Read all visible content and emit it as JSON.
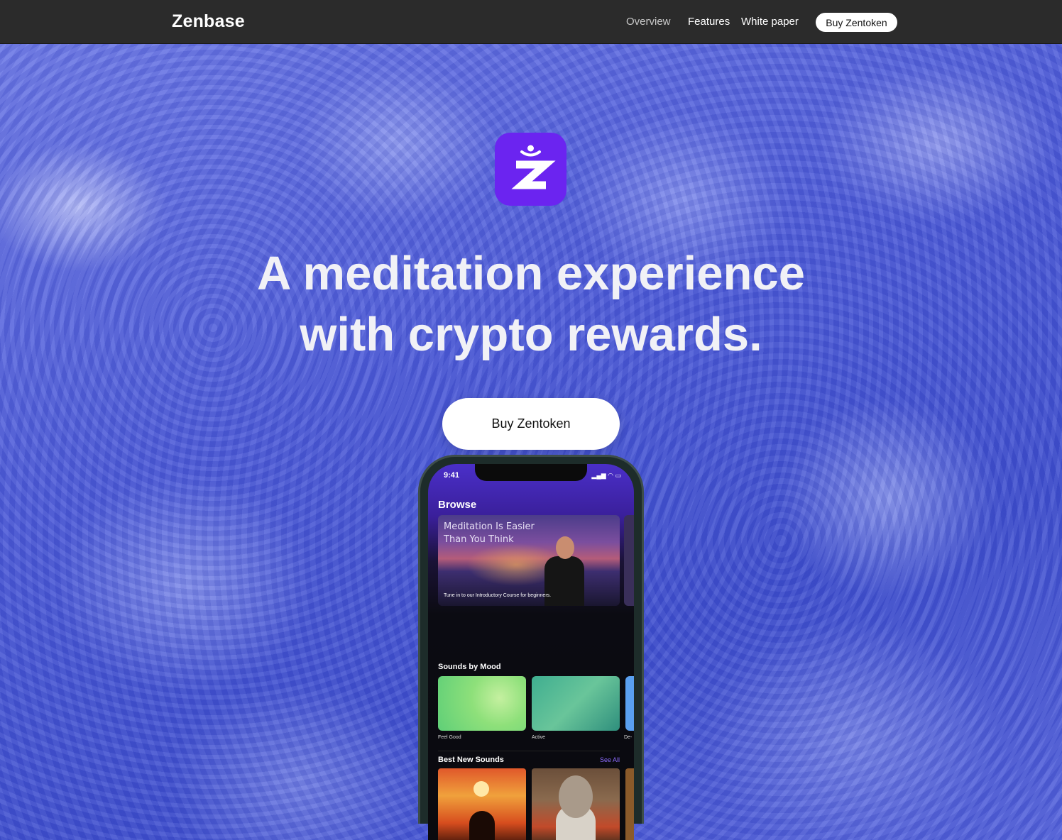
{
  "nav": {
    "brand": "Zenbase",
    "links": [
      "Overview",
      "Features",
      "White paper"
    ],
    "button": "Buy Zentoken"
  },
  "hero": {
    "headline_line1": "A meditation experience",
    "headline_line2": "with crypto rewards.",
    "cta": "Buy Zentoken",
    "logo_color": "#6b24f0",
    "logo_glyph": "zenbase-z-icon"
  },
  "phone": {
    "time": "9:41",
    "status_icons": "signal-wifi-battery-icons",
    "browse_title": "Browse",
    "feature_title": "Meditation Is Easier Than You Think",
    "feature_subtitle": "Tune in to our Introductory Course for beginners.",
    "sounds_by_mood_title": "Sounds by Mood",
    "moods": [
      "Feel Good",
      "Active",
      "De-"
    ],
    "best_new_sounds_title": "Best New Sounds",
    "see_all": "See All"
  }
}
